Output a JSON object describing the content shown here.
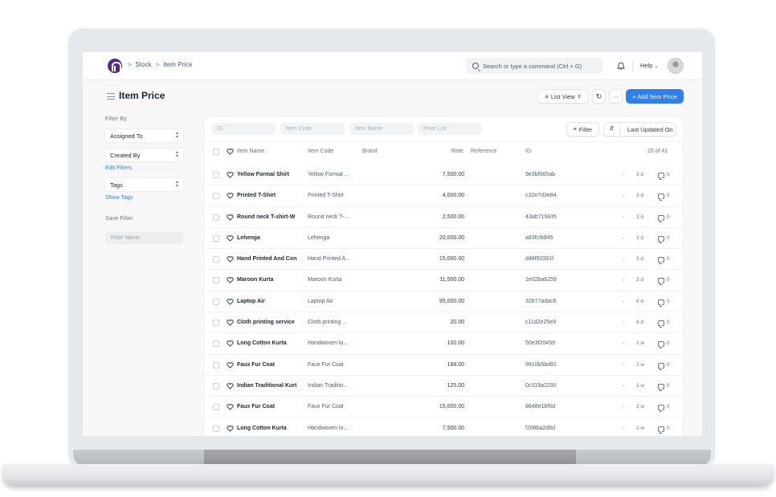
{
  "navbar": {
    "breadcrumbs": [
      "Stock",
      "Item Price"
    ],
    "search_placeholder": "Search or type a command (Ctrl + G)",
    "help_label": "Help"
  },
  "page": {
    "title": "Item Price",
    "view_switcher_label": "List View",
    "more_label": "···",
    "primary_button_label": "+ Add Item Price"
  },
  "sidebar": {
    "filter_by_label": "Filter By",
    "selects": [
      "Assigned To",
      "Created By"
    ],
    "edit_filters_label": "Edit Filters",
    "tags_label": "Tags",
    "show_tags_label": "Show Tags",
    "save_filter_label": "Save Filter",
    "filter_name_placeholder": "Filter Name"
  },
  "list": {
    "filter_placeholders": [
      "ID",
      "Item Code",
      "Item Name",
      "Price List"
    ],
    "filter_button_label": "Filter",
    "sort_label": "Last Updated On",
    "columns": [
      "Item Name",
      "Item Code",
      "Brand",
      "Rate",
      "Reference",
      "ID"
    ],
    "count_label": "20 of 41",
    "rows": [
      {
        "name": "Yellow Formal Shirt",
        "code": "Yellow Formal ...",
        "rate": "7,500.00",
        "id": "9e3bf065ab",
        "dash": "-",
        "age": "3 d",
        "comments": "0"
      },
      {
        "name": "Printed T-Shirt",
        "code": "Printed T-Shirt",
        "rate": "4,000.00",
        "id": "c32e7d3e84",
        "dash": "-",
        "age": "3 d",
        "comments": "0"
      },
      {
        "name": "Round neck T-shirt-W",
        "code": "Round neck T-...",
        "rate": "2,500.00",
        "id": "43ab715835",
        "dash": "-",
        "age": "3 d",
        "comments": "0"
      },
      {
        "name": "Lehenga",
        "code": "Lehenga",
        "rate": "20,000.00",
        "id": "a83fc9df45",
        "dash": "-",
        "age": "3 d",
        "comments": "0"
      },
      {
        "name": "Hand Printed And Con",
        "code": "Hand Printed A...",
        "rate": "15,000.00",
        "id": "d48f92081f",
        "dash": "-",
        "age": "3 d",
        "comments": "0"
      },
      {
        "name": "Maroon Kurta",
        "code": "Maroon Kurta",
        "rate": "11,500.00",
        "id": "1e02ba6259",
        "dash": "-",
        "age": "3 d",
        "comments": "0"
      },
      {
        "name": "Laptop Air",
        "code": "Laptop Air",
        "rate": "95,000.00",
        "id": "32877adac6",
        "dash": "-",
        "age": "6 d",
        "comments": "0"
      },
      {
        "name": "Cloth printing service",
        "code": "Cloth printing ...",
        "rate": "20.00",
        "id": "c11d2e25e9",
        "dash": "-",
        "age": "6 d",
        "comments": "0"
      },
      {
        "name": "Long Cotton Kurta",
        "code": "Handwoven lo...",
        "rate": "100.00",
        "id": "50e3f20459",
        "dash": "-",
        "age": "2 w",
        "comments": "0"
      },
      {
        "name": "Faux Fur Coat",
        "code": "Faux Fur Coat",
        "rate": "188.00",
        "id": "9910b5bd81",
        "dash": "-",
        "age": "2 w",
        "comments": "0"
      },
      {
        "name": "Indian Traditional Kurt",
        "code": "Indian Traditio...",
        "rate": "125.00",
        "id": "0c319a2230",
        "dash": "-",
        "age": "2 w",
        "comments": "0"
      },
      {
        "name": "Faux Fur Coat",
        "code": "Faux Fur Coat",
        "rate": "15,000.00",
        "id": "8648e1bf6d",
        "dash": "-",
        "age": "2 w",
        "comments": "0"
      },
      {
        "name": "Long Cotton Kurta",
        "code": "Handwoven lo...",
        "rate": "7,500.00",
        "id": "f208ba2d6d",
        "dash": "-",
        "age": "2 w",
        "comments": "0"
      }
    ]
  },
  "colors": {
    "primary": "#2f80ed",
    "logo": "#5b2a86"
  }
}
